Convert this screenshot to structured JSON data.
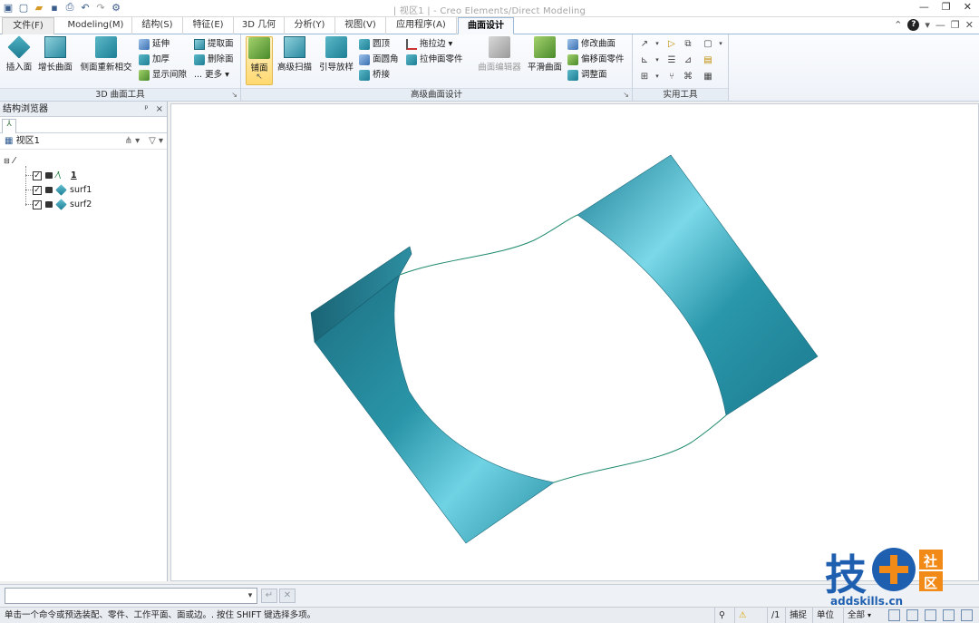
{
  "window": {
    "title": "| 视区1 |  -  Creo Elements/Direct Modeling",
    "controls": [
      "—",
      "❐",
      "✕"
    ]
  },
  "quick_access": [
    "app-icon",
    "new-icon",
    "open-icon",
    "save-icon",
    "print-preview-icon",
    "undo-icon",
    "redo-icon",
    "settings-icon"
  ],
  "tabs": [
    {
      "label": "文件(F)",
      "name": "file"
    },
    {
      "label": "Modeling(M)",
      "name": "modeling"
    },
    {
      "label": "结构(S)",
      "name": "structure"
    },
    {
      "label": "特征(E)",
      "name": "features"
    },
    {
      "label": "3D 几何",
      "name": "3d-geometry"
    },
    {
      "label": "分析(Y)",
      "name": "analysis"
    },
    {
      "label": "视图(V)",
      "name": "view"
    },
    {
      "label": "应用程序(A)",
      "name": "applications"
    },
    {
      "label": "曲面设计",
      "name": "surface-design"
    }
  ],
  "ribbon": {
    "group1": {
      "label": "3D 曲面工具",
      "big": [
        "插入面",
        "增长曲面",
        "侧面重新相交"
      ],
      "small_col1": [
        "延伸",
        "加厚",
        "显示间隙"
      ],
      "small_col2": [
        "提取面",
        "删除面",
        "... 更多"
      ]
    },
    "group2": {
      "label": "高级曲面设计",
      "big": [
        "铺面",
        "高级扫描",
        "引导放样"
      ],
      "small_col1": [
        "圆顶",
        "面圆角",
        "桥接"
      ],
      "small_col2": [
        "拖拉边",
        "拉伸面零件"
      ],
      "big2": [
        "曲面编辑器",
        "平滑曲面"
      ],
      "small_col3": [
        "修改曲面",
        "偏移面零件",
        "调整面"
      ]
    },
    "group3": {
      "label": "实用工具"
    }
  },
  "browser": {
    "title": "结构浏览器",
    "viewport": "视区1",
    "items": [
      {
        "label": "1",
        "type": "curve"
      },
      {
        "label": "surf1",
        "type": "surface"
      },
      {
        "label": "surf2",
        "type": "surface"
      }
    ]
  },
  "cmdline": {
    "value": "",
    "enter_label": "↵",
    "cancel_label": "✕"
  },
  "status": {
    "message": "单击一个命令或预选装配、零件、工作平面、面或边。. 按住 SHIFT 键选择多项。",
    "page": "/1",
    "snap": "捕捉",
    "units": "单位",
    "filter": "全部"
  },
  "watermark": {
    "char1": "技",
    "char2a": "社",
    "char2b": "区",
    "url": "addskills.cn"
  },
  "colors": {
    "surface": "#2a95a8",
    "accent": "#3f7fc0",
    "brand_orange": "#f28a17",
    "brand_blue": "#1f5fb0"
  }
}
